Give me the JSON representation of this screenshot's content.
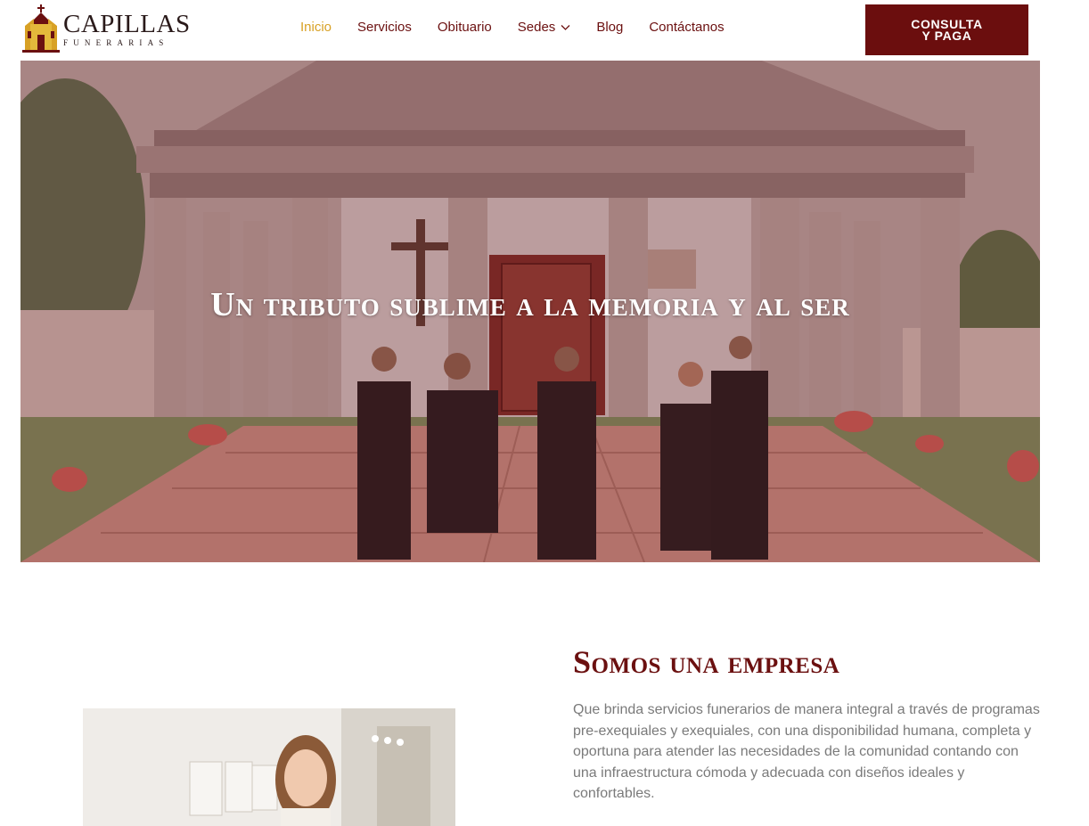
{
  "brand": {
    "name": "CAPILLAS",
    "tagline": "FUNERARIAS"
  },
  "nav": {
    "items": [
      {
        "label": "Inicio",
        "active": true
      },
      {
        "label": "Servicios"
      },
      {
        "label": "Obituario"
      },
      {
        "label": "Sedes",
        "has_dropdown": true
      },
      {
        "label": "Blog"
      },
      {
        "label": "Contáctanos"
      }
    ],
    "cta_line1": "CONSULTA",
    "cta_line2": "Y PAGA"
  },
  "hero": {
    "title": "Un tributo sublime a la memoria y al ser"
  },
  "about": {
    "title": "Somos una empresa",
    "text": "Que brinda servicios funerarios de manera integral a través de programas pre-exequiales y exequiales, con una disponibilidad humana, completa y oportuna para atender las necesidades de la comunidad contando con una infraestructura cómoda y adecuada con diseños ideales y confortables."
  },
  "colors": {
    "brand_dark_red": "#6b0e0e",
    "active_gold": "#d8a125",
    "text_gray": "#7a7a7a"
  }
}
